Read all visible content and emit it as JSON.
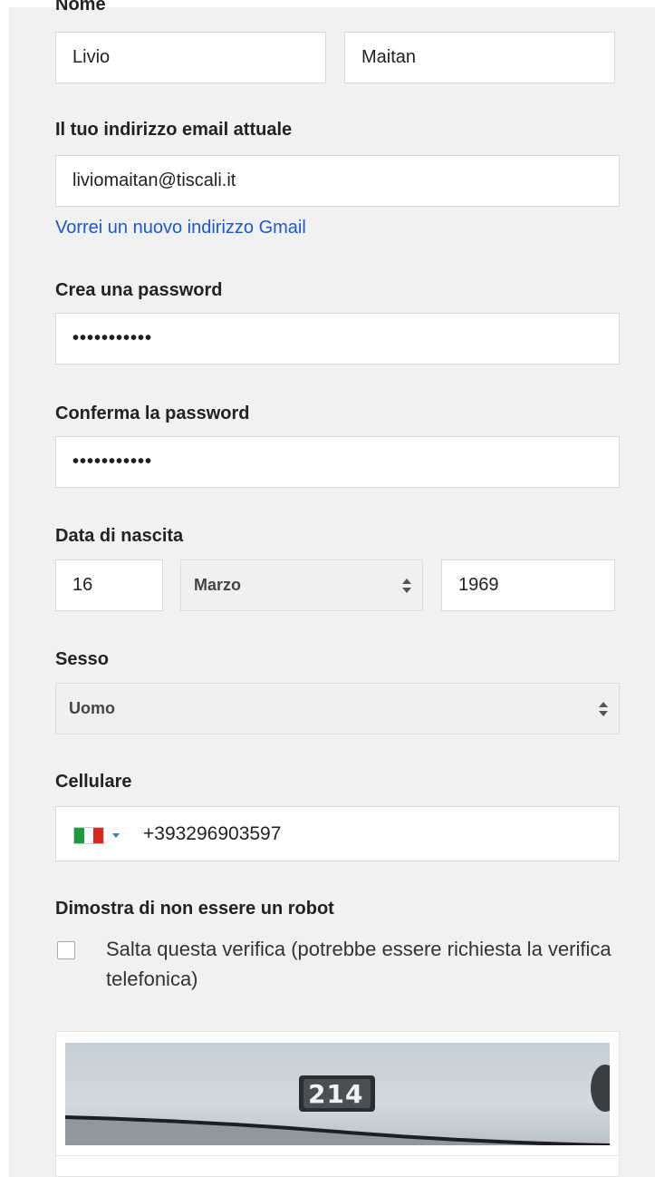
{
  "form": {
    "name": {
      "label": "Nome",
      "first_name": "Livio",
      "last_name": "Maitan"
    },
    "email": {
      "label": "Il tuo indirizzo email attuale",
      "value": "liviomaitan@tiscali.it",
      "gmail_link": "Vorrei un nuovo indirizzo Gmail"
    },
    "password": {
      "label": "Crea una password",
      "value": "•••••••••••"
    },
    "confirm_password": {
      "label": "Conferma la password",
      "value": "•••••••••••"
    },
    "birthdate": {
      "label": "Data di nascita",
      "day": "16",
      "month": "Marzo",
      "year": "1969"
    },
    "gender": {
      "label": "Sesso",
      "value": "Uomo"
    },
    "mobile": {
      "label": "Cellulare",
      "country_icon": "italy-flag-icon",
      "number": "+393296903597"
    },
    "robot": {
      "label": "Dimostra di non essere un robot",
      "skip_text": "Salta questa verifica (potrebbe essere richiesta la verifica telefonica)",
      "skip_checked": false
    },
    "captcha": {
      "image_text": "214"
    }
  },
  "colors": {
    "link": "#1a57d6",
    "panel_bg": "#f1f1f1",
    "flag_green": "#1a9b3c",
    "flag_white": "#ffffff",
    "flag_red": "#d52b1e"
  }
}
